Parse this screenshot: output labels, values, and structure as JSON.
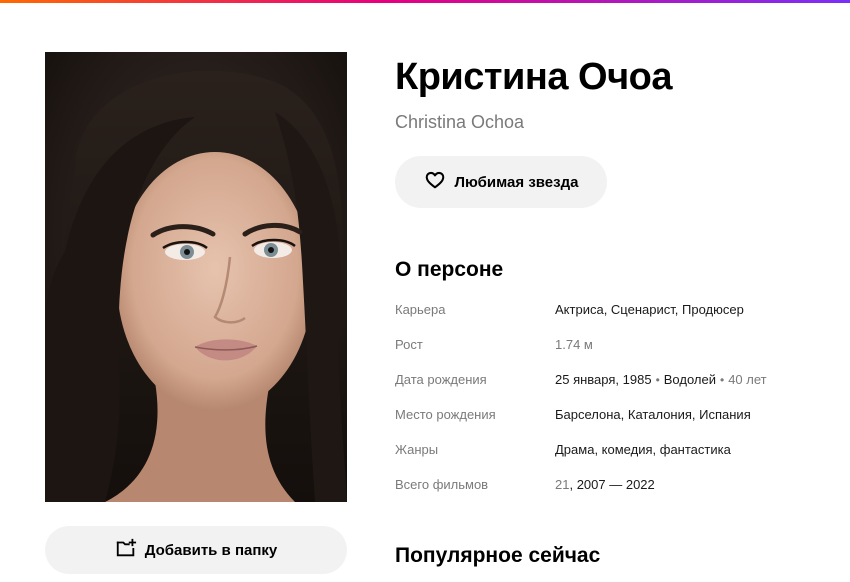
{
  "person": {
    "name_ru": "Кристина Очоа",
    "name_en": "Christina Ochoa"
  },
  "buttons": {
    "favorite_label": "Любимая звезда",
    "favorite_icon": "heart-icon",
    "add_to_folder_label": "Добавить в папку",
    "add_to_folder_icon": "folder-plus-icon"
  },
  "about": {
    "title": "О персоне",
    "career": {
      "label": "Карьера",
      "items": [
        "Актриса",
        "Сценарист",
        "Продюсер"
      ]
    },
    "height": {
      "label": "Рост",
      "value": "1.74 м"
    },
    "birth": {
      "label": "Дата рождения",
      "date": "25 января, 1985",
      "zodiac": "Водолей",
      "age": "40 лет"
    },
    "birthplace": {
      "label": "Место рождения",
      "items": [
        "Барселона",
        "Каталония",
        "Испания"
      ]
    },
    "genres": {
      "label": "Жанры",
      "items": [
        "Драма",
        "комедия",
        "фантастика"
      ]
    },
    "films": {
      "label": "Всего фильмов",
      "count": "21",
      "years": "2007 — 2022"
    }
  },
  "popular": {
    "title": "Популярное сейчас"
  },
  "colors": {
    "accent_gradient": [
      "#ff6a00",
      "#e6007e",
      "#7b2ff7"
    ],
    "button_bg": "#f2f2f2",
    "muted_text": "#7a7a7a"
  }
}
